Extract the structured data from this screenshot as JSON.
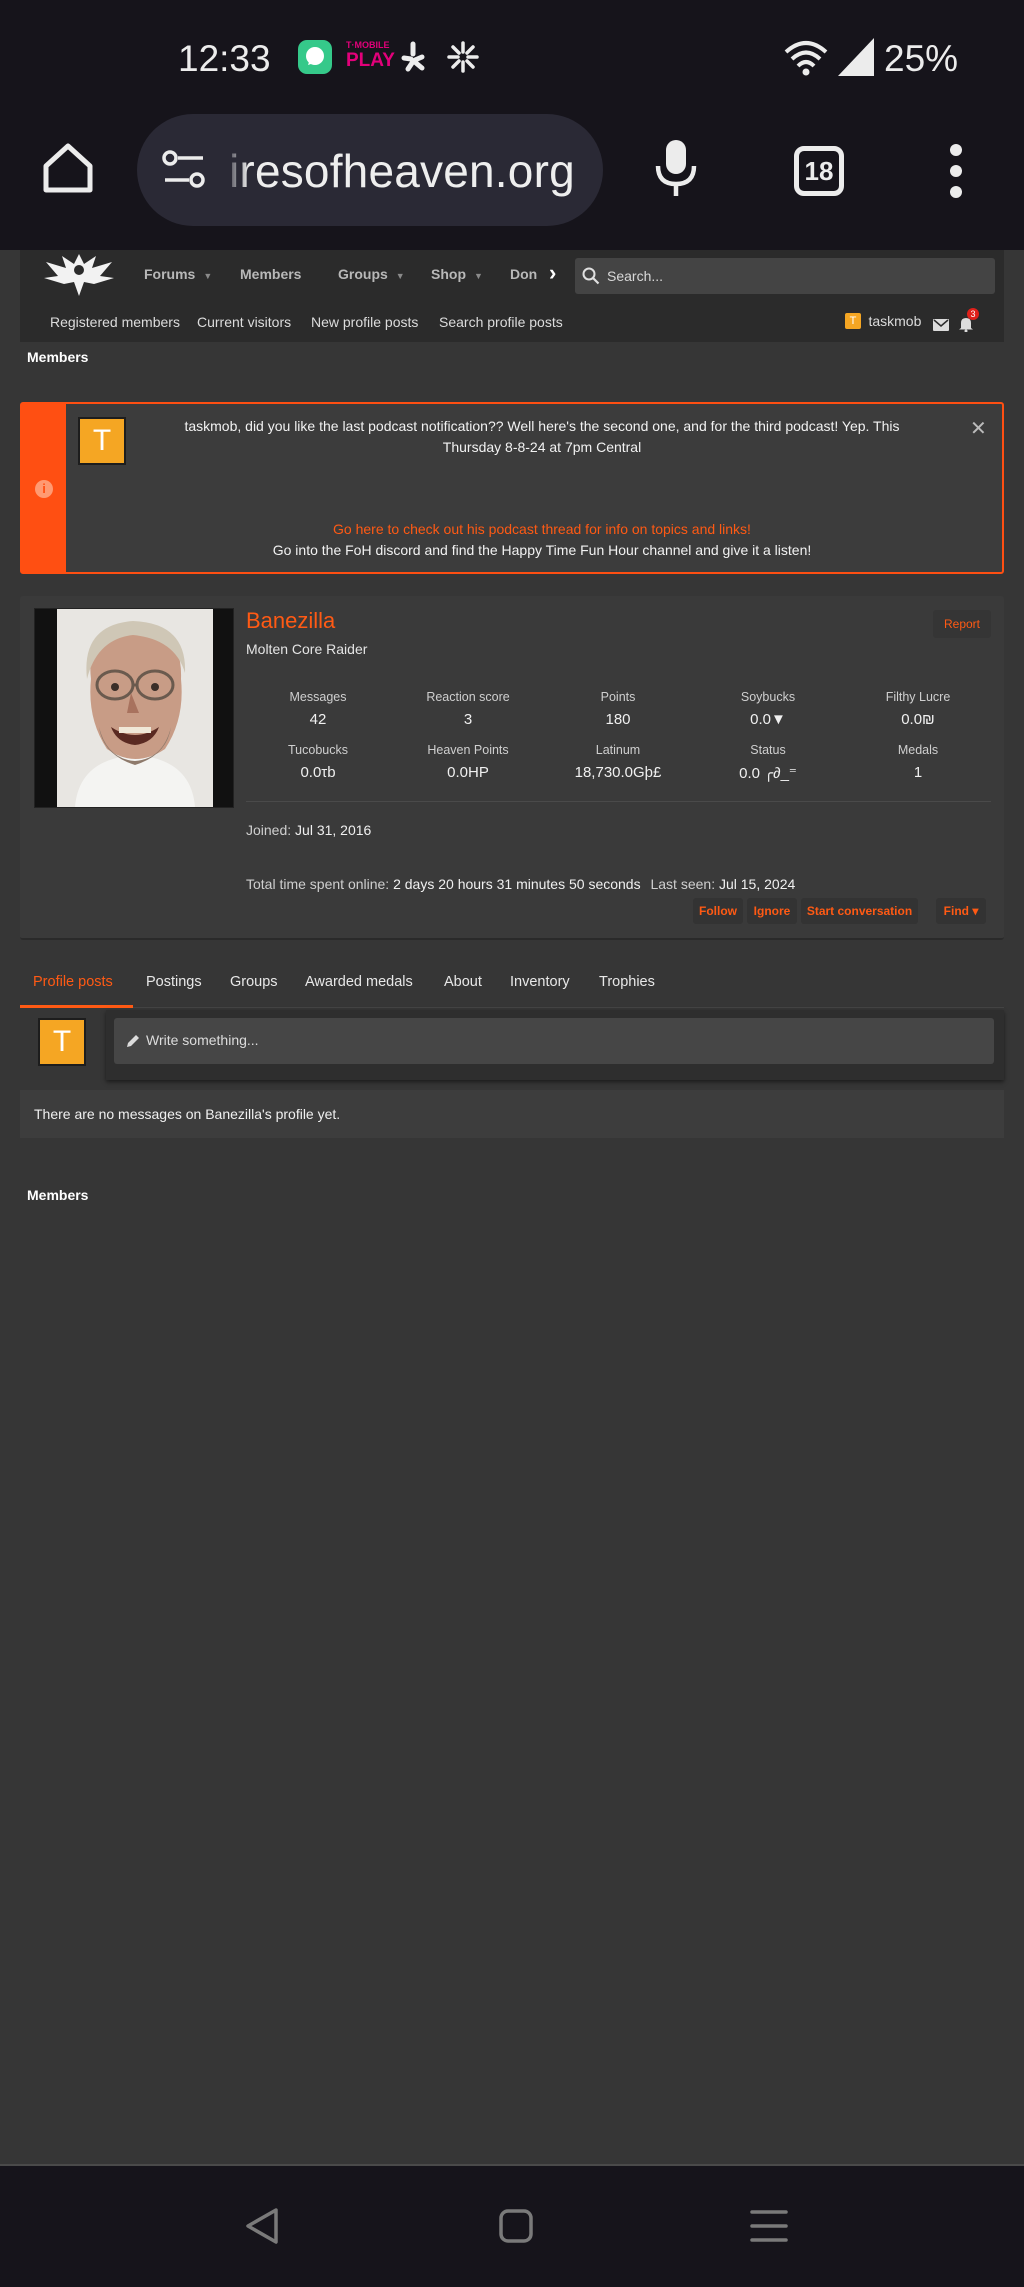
{
  "status_bar": {
    "time": "12:33",
    "icons": [
      "messages-icon",
      "tmobile-play-icon",
      "yelp-icon",
      "asterisk-icon",
      "wifi-icon",
      "signal-icon"
    ],
    "tmobile_top": "T·MOBILE",
    "tmobile_bottom": "PLAY",
    "battery": "25%"
  },
  "browser": {
    "url": "iresofheaven.org",
    "tab_count": "18"
  },
  "site_nav": {
    "items": [
      {
        "label": "Forums"
      },
      {
        "label": "Members"
      },
      {
        "label": "Groups"
      },
      {
        "label": "Shop"
      },
      {
        "label": "Don"
      }
    ],
    "more_glyph": "›",
    "search_placeholder": "Search...",
    "sub_items": [
      {
        "label": "Registered members"
      },
      {
        "label": "Current visitors"
      },
      {
        "label": "New profile posts"
      },
      {
        "label": "Search profile posts"
      }
    ],
    "user_initial": "T",
    "user_name": "taskmob",
    "alert_count": "3"
  },
  "breadcrumb": "Members",
  "notice": {
    "avatar_letter": "T",
    "line1": "taskmob, did you like the last podcast notification?? Well here's the second one, and for the third podcast! Yep. This",
    "line2": "Thursday 8-8-24 at 7pm Central",
    "link": "Go here to check out his podcast thread for info on topics and links!",
    "line3": "Go into the FoH discord and find the Happy Time Fun Hour channel and give it a listen!",
    "close": "✕",
    "info": "i",
    "accent": "#ff4f12"
  },
  "profile": {
    "username": "Banezilla",
    "user_title": "Molten Core Raider",
    "report_label": "Report",
    "stats": [
      {
        "label": "Messages",
        "value": "42"
      },
      {
        "label": "Reaction score",
        "value": "3"
      },
      {
        "label": "Points",
        "value": "180"
      },
      {
        "label": "Soybucks",
        "value": "0.0▼"
      },
      {
        "label": "Filthy Lucre",
        "value": "0.0₪"
      },
      {
        "label": "Tucobucks",
        "value": "0.0τb"
      },
      {
        "label": "Heaven Points",
        "value": "0.0HP"
      },
      {
        "label": "Latinum",
        "value": "18,730.0Gþ£"
      },
      {
        "label": "Status",
        "value": "0.0 ╭∂_⁼"
      },
      {
        "label": "Medals",
        "value": "1"
      }
    ],
    "joined_label": "Joined:",
    "joined_value": "Jul 31, 2016",
    "online_label": "Total time spent online:",
    "online_value": "2 days 20 hours 31 minutes 50 seconds",
    "seen_label": "Last seen:",
    "seen_value": "Jul 15, 2024",
    "actions": [
      "Follow",
      "Ignore",
      "Start conversation",
      "Find ▾"
    ]
  },
  "tabs": [
    "Profile posts",
    "Postings",
    "Groups",
    "Awarded medals",
    "About",
    "Inventory",
    "Trophies"
  ],
  "composer": {
    "avatar_letter": "T",
    "placeholder": "Write something..."
  },
  "empty_message": "There are no messages on Banezilla's profile yet.",
  "footer_breadcrumb": "Members"
}
